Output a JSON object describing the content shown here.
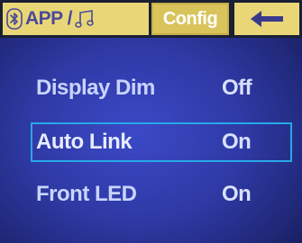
{
  "tabs": {
    "app_label": "APP /",
    "config_label": "Config"
  },
  "menu": {
    "items": [
      {
        "label": "Display Dim",
        "value": "Off"
      },
      {
        "label": "Auto Link",
        "value": "On"
      },
      {
        "label": "Front LED",
        "value": "On"
      }
    ],
    "selected_index": 1
  },
  "colors": {
    "background": "#2f3aa6",
    "tab_fill": "#e9d777",
    "selection_border": "#27a8e8",
    "text": "#c9d4ff"
  },
  "icons": [
    "bluetooth-icon",
    "music-note-icon",
    "back-arrow-icon"
  ]
}
